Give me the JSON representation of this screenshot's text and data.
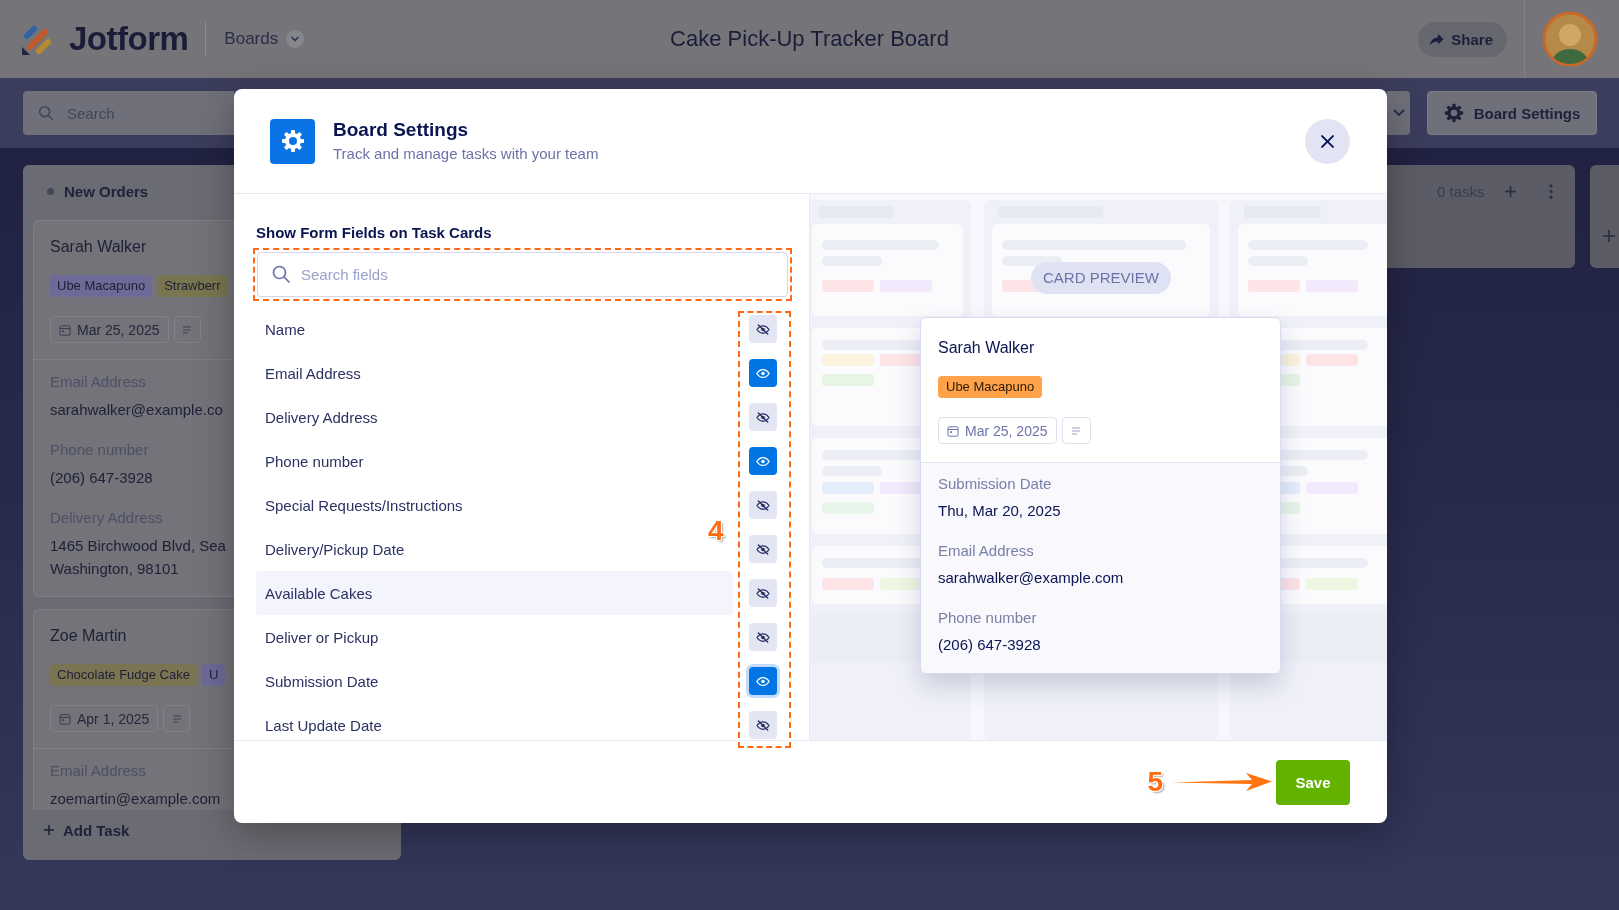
{
  "header": {
    "logo": "Jotform",
    "boards_menu": "Boards",
    "title": "Cake Pick-Up Tracker Board",
    "share_button": "Share"
  },
  "toolbar": {
    "search": {
      "placeholder": "Search"
    },
    "settings_button": "Board Settings"
  },
  "board": {
    "columns": [
      {
        "kind": "full",
        "title": "New Orders",
        "cards": [
          {
            "name": "Sarah Walker",
            "tags": [
              {
                "label": "Ube Macapuno",
                "color": "#6d6a98"
              },
              {
                "label": "Strawberr",
                "color": "#79764f"
              }
            ],
            "date": "Mar 25, 2025",
            "fields": [
              {
                "label": "Email Address",
                "lines": [
                  "sarahwalker@example.co"
                ]
              },
              {
                "label": "Phone number",
                "lines": [
                  "(206) 647-3928"
                ]
              },
              {
                "label": "Delivery Address",
                "lines": [
                  "1465 Birchwood Blvd, Sea",
                  "Washington, 98101"
                ]
              }
            ]
          },
          {
            "name": "Zoe Martin",
            "tags": [
              {
                "label": "Chocolate Fudge Cake",
                "color": "#7b7452"
              },
              {
                "label": "U",
                "color": "#6d6a98"
              }
            ],
            "date": "Apr 1, 2025",
            "fields": [
              {
                "label": "Email Address",
                "lines": [
                  "zoemartin@example.com"
                ]
              }
            ]
          }
        ],
        "add_task": "Add Task"
      },
      {
        "kind": "partial",
        "task_count": "0 tasks"
      },
      {
        "kind": "edge"
      }
    ]
  },
  "modal": {
    "title": "Board Settings",
    "subtitle": "Track and manage tasks with your team",
    "section_title": "Show Form Fields on Task Cards",
    "search": {
      "placeholder": "Search fields",
      "outlined": true
    },
    "toggles_outlined": true,
    "fields": [
      {
        "label": "Name",
        "visible": false,
        "highlighted": false,
        "focused": false
      },
      {
        "label": "Email Address",
        "visible": true,
        "highlighted": false,
        "focused": false
      },
      {
        "label": "Delivery Address",
        "visible": false,
        "highlighted": false,
        "focused": false
      },
      {
        "label": "Phone number",
        "visible": true,
        "highlighted": false,
        "focused": false
      },
      {
        "label": "Special Requests/Instructions",
        "visible": false,
        "highlighted": false,
        "focused": false
      },
      {
        "label": "Delivery/Pickup Date",
        "visible": false,
        "highlighted": false,
        "focused": false
      },
      {
        "label": "Available Cakes",
        "visible": false,
        "highlighted": true,
        "focused": false
      },
      {
        "label": "Deliver or Pickup",
        "visible": false,
        "highlighted": false,
        "focused": false
      },
      {
        "label": "Submission Date",
        "visible": true,
        "highlighted": false,
        "focused": true
      },
      {
        "label": "Last Update Date",
        "visible": false,
        "highlighted": false,
        "focused": false
      }
    ],
    "callouts": [
      {
        "kind": "number",
        "text": "4"
      },
      {
        "kind": "arrow",
        "text": "5"
      }
    ],
    "preview": {
      "badge": "CARD PREVIEW",
      "card": {
        "name": "Sarah Walker",
        "tag": {
          "label": "Ube Macapuno",
          "color": "#ffa24a"
        },
        "date": "Mar 25, 2025",
        "fields": [
          {
            "label": "Submission Date",
            "value": "Thu, Mar 20, 2025"
          },
          {
            "label": "Email Address",
            "value": "sarahwalker@example.com"
          },
          {
            "label": "Phone number",
            "value": "(206) 647-3928"
          }
        ]
      }
    },
    "save_button": "Save"
  }
}
